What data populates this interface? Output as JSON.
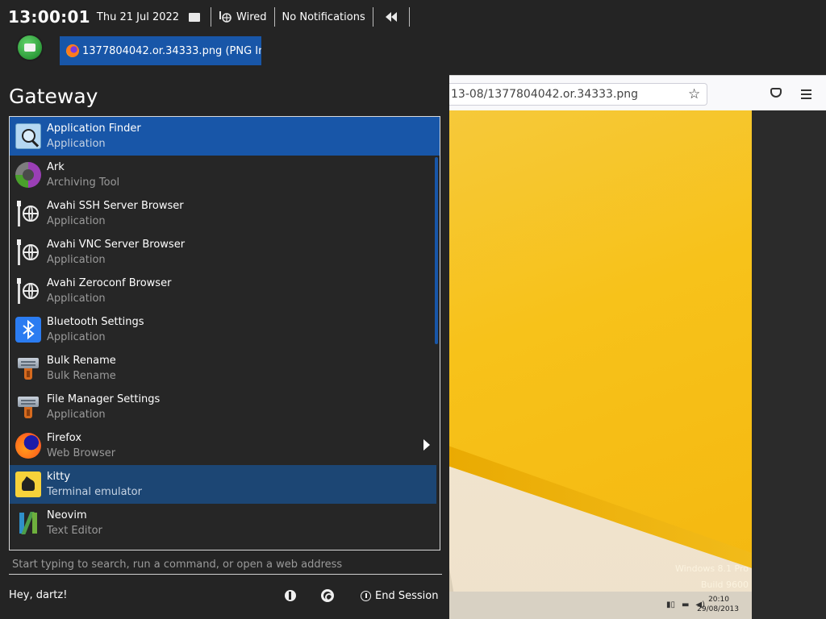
{
  "panel": {
    "clock": "13:00:01",
    "date": "Thu 21 Jul 2022",
    "network_label": "Wired",
    "notifications_label": "No Notifications"
  },
  "taskbar": {
    "active_window_title": "1377804042.or.34333.png (PNG Im"
  },
  "browser": {
    "url": "13-08/1377804042.or.34333.png",
    "page_watermark_line1": "Windows 8.1 Pro",
    "page_watermark_line2": "Build 9600",
    "page_clock_time": "20:10",
    "page_clock_date": "29/08/2013"
  },
  "menu": {
    "title": "Gateway",
    "apps": [
      {
        "name": "Application Finder",
        "desc": "Application",
        "icon": "application-finder-icon"
      },
      {
        "name": "Ark",
        "desc": "Archiving Tool",
        "icon": "ark-icon"
      },
      {
        "name": "Avahi SSH Server Browser",
        "desc": "Application",
        "icon": "globe-icon"
      },
      {
        "name": "Avahi VNC Server Browser",
        "desc": "Application",
        "icon": "globe-icon"
      },
      {
        "name": "Avahi Zeroconf Browser",
        "desc": "Application",
        "icon": "globe-icon"
      },
      {
        "name": "Bluetooth Settings",
        "desc": "Application",
        "icon": "bluetooth-icon"
      },
      {
        "name": "Bulk Rename",
        "desc": "Bulk Rename",
        "icon": "bulk-rename-icon"
      },
      {
        "name": "File Manager Settings",
        "desc": "Application",
        "icon": "file-manager-settings-icon"
      },
      {
        "name": "Firefox",
        "desc": "Web Browser",
        "icon": "firefox-icon"
      },
      {
        "name": "kitty",
        "desc": "Terminal emulator",
        "icon": "kitty-icon"
      },
      {
        "name": "Neovim",
        "desc": "Text Editor",
        "icon": "neovim-icon"
      }
    ],
    "search_placeholder": "Start typing to search, run a command, or open a web address",
    "greeting": "Hey, dartz!",
    "end_session_label": "End Session"
  },
  "colors": {
    "background": "#242424",
    "selection": "#1856a8",
    "hover": "#1c4674"
  }
}
